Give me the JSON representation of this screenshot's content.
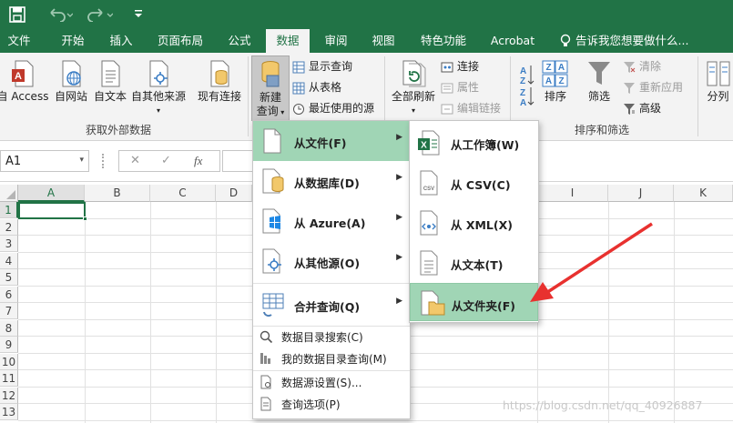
{
  "quick_access": {
    "save_icon": "save-icon",
    "undo_icon": "undo-icon",
    "redo_icon": "redo-icon",
    "customize_icon": "customize-icon"
  },
  "tabs": [
    {
      "label": "文件"
    },
    {
      "label": "开始"
    },
    {
      "label": "插入"
    },
    {
      "label": "页面布局"
    },
    {
      "label": "公式"
    },
    {
      "label": "数据",
      "active": true
    },
    {
      "label": "审阅"
    },
    {
      "label": "视图"
    },
    {
      "label": "特色功能"
    },
    {
      "label": "Acrobat"
    }
  ],
  "tell_me": "告诉我您想要做什么...",
  "ribbon": {
    "external_group": {
      "from_access": "自 Access",
      "from_web": "自网站",
      "from_text": "自文本",
      "from_other": "自其他来源",
      "existing": "现有连接",
      "label": "获取外部数据"
    },
    "query_group": {
      "new_query_line1": "新建",
      "new_query_line2": "查询",
      "show_queries": "显示查询",
      "from_table": "从表格",
      "recent_sources": "最近使用的源"
    },
    "connections_group": {
      "refresh_all": "全部刷新",
      "connections": "连接",
      "properties": "属性",
      "edit_links": "编辑链接"
    },
    "sort_group": {
      "sort": "排序",
      "filter": "筛选",
      "clear": "清除",
      "reapply": "重新应用",
      "advanced": "高级",
      "label": "排序和筛选",
      "az": "A Z",
      "za": "Z A"
    },
    "split": "分列"
  },
  "formula_bar": {
    "name_box": "A1",
    "cancel": "✕",
    "enter": "✓",
    "fx": "fx"
  },
  "columns": [
    "A",
    "B",
    "C",
    "D",
    "I",
    "J",
    "K"
  ],
  "rows": [
    "1",
    "2",
    "3",
    "4",
    "5",
    "6",
    "7",
    "8",
    "9",
    "10",
    "11",
    "12",
    "13"
  ],
  "menu1": {
    "items": [
      {
        "label": "从文件(F)"
      },
      {
        "label": "从数据库(D)"
      },
      {
        "label": "从 Azure(A)"
      },
      {
        "label": "从其他源(O)"
      },
      {
        "label": "合并查询(Q)"
      }
    ],
    "small_items": [
      {
        "label": "数据目录搜索(C)"
      },
      {
        "label": "我的数据目录查询(M)"
      },
      {
        "label": "数据源设置(S)..."
      },
      {
        "label": "查询选项(P)"
      }
    ]
  },
  "menu2": {
    "items": [
      {
        "label": "从工作簿(W)"
      },
      {
        "label": "从 CSV(C)"
      },
      {
        "label": "从 XML(X)"
      },
      {
        "label": "从文本(T)"
      },
      {
        "label": "从文件夹(F)"
      }
    ]
  },
  "watermark": "https://blog.csdn.net/qq_40926887",
  "colors": {
    "accent": "#217346",
    "highlight": "#a0d5b5",
    "arrow": "#e8312f"
  }
}
